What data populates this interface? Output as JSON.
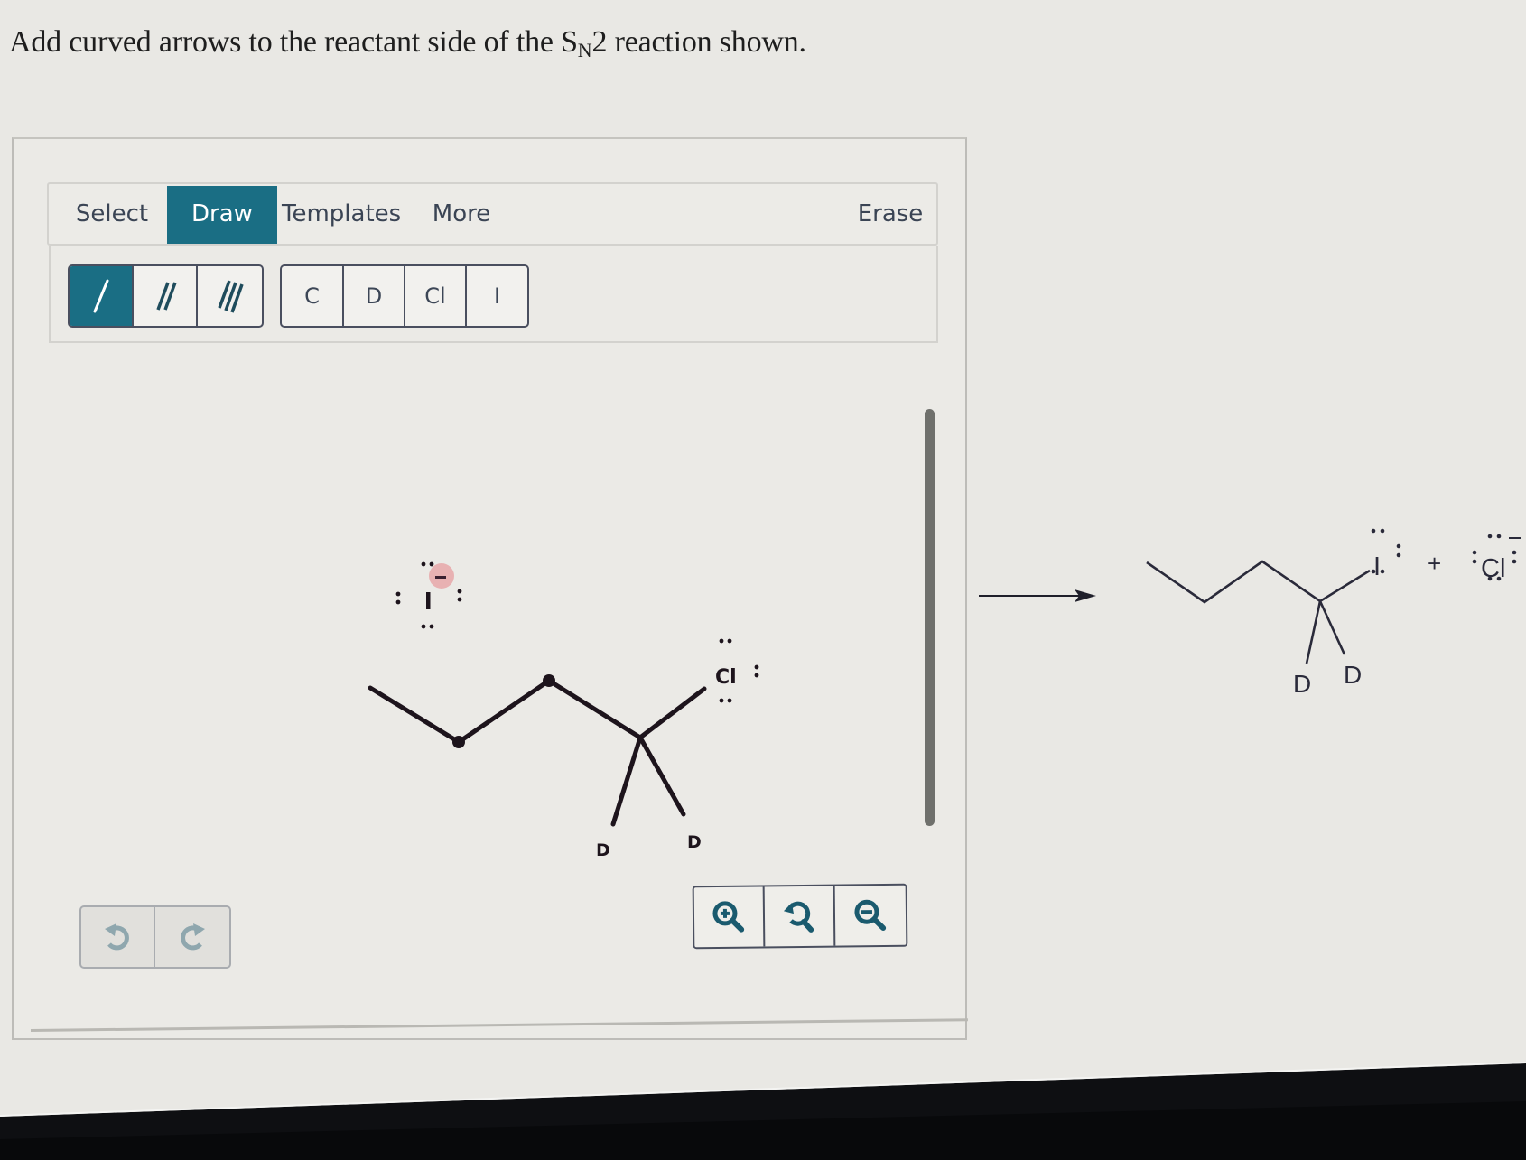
{
  "question": {
    "prefix": "Add curved arrows to the reactant side of the S",
    "subscript": "N",
    "suffix": "2 reaction shown."
  },
  "toolbar": {
    "tabs": [
      {
        "label": "Select",
        "active": false
      },
      {
        "label": "Draw",
        "active": true
      },
      {
        "label": "Templates",
        "active": false
      },
      {
        "label": "More",
        "active": false
      }
    ],
    "erase_label": "Erase"
  },
  "bond_tools": [
    {
      "name": "single-bond",
      "icon": "single-bond-icon",
      "active": true
    },
    {
      "name": "double-bond",
      "icon": "double-bond-icon",
      "active": false
    },
    {
      "name": "triple-bond",
      "icon": "triple-bond-icon",
      "active": false
    }
  ],
  "atom_tools": [
    "C",
    "D",
    "Cl",
    "I"
  ],
  "reactant": {
    "nucleophile": {
      "symbol": "I",
      "charge": "−",
      "lone_pairs": 4
    },
    "substrate_atoms": {
      "leaving_group": "Cl",
      "substituents": [
        "D",
        "D"
      ]
    },
    "leaving_group_lone_pairs": 3
  },
  "product": {
    "main": {
      "halogen": "I",
      "substituents": [
        "D",
        "D"
      ]
    },
    "plus": "+",
    "byproduct": {
      "symbol": "Cl",
      "charge": "−"
    }
  },
  "history_buttons": [
    {
      "name": "undo",
      "icon": "undo-icon"
    },
    {
      "name": "redo",
      "icon": "redo-icon"
    }
  ],
  "zoom_buttons": [
    {
      "name": "zoom-in",
      "icon": "zoom-in-icon"
    },
    {
      "name": "zoom-reset",
      "icon": "zoom-reset-icon"
    },
    {
      "name": "zoom-out",
      "icon": "zoom-out-icon"
    }
  ],
  "colors": {
    "accent": "#1a6e84",
    "background": "#e9e8e4",
    "charge_highlight": "#e8a7a8"
  }
}
